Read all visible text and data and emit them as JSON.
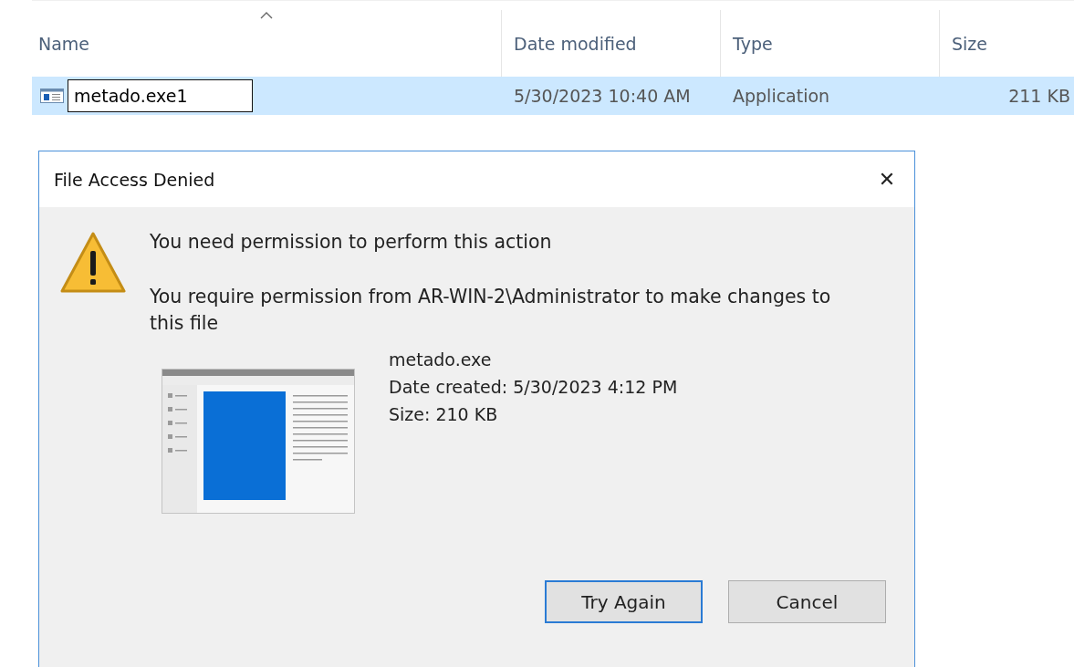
{
  "columns": [
    {
      "label": "Name",
      "sorted": true
    },
    {
      "label": "Date modified",
      "sorted": false
    },
    {
      "label": "Type",
      "sorted": false
    },
    {
      "label": "Size",
      "sorted": false
    }
  ],
  "files": [
    {
      "selected": true,
      "rename_value": "metado.exe1",
      "date_modified": "5/30/2023 10:40 AM",
      "type": "Application",
      "size": "211 KB"
    }
  ],
  "dialog": {
    "title": "File Access Denied",
    "close": "✕",
    "heading": "You need permission to perform this action",
    "message": "You require permission from AR-WIN-2\\Administrator to make changes to this file",
    "file_name": "metado.exe",
    "date_created": "Date created: 5/30/2023 4:12 PM",
    "file_size": "Size: 210 KB",
    "buttons": [
      {
        "label": "Try Again",
        "focused": true
      },
      {
        "label": "Cancel",
        "focused": false
      }
    ]
  }
}
